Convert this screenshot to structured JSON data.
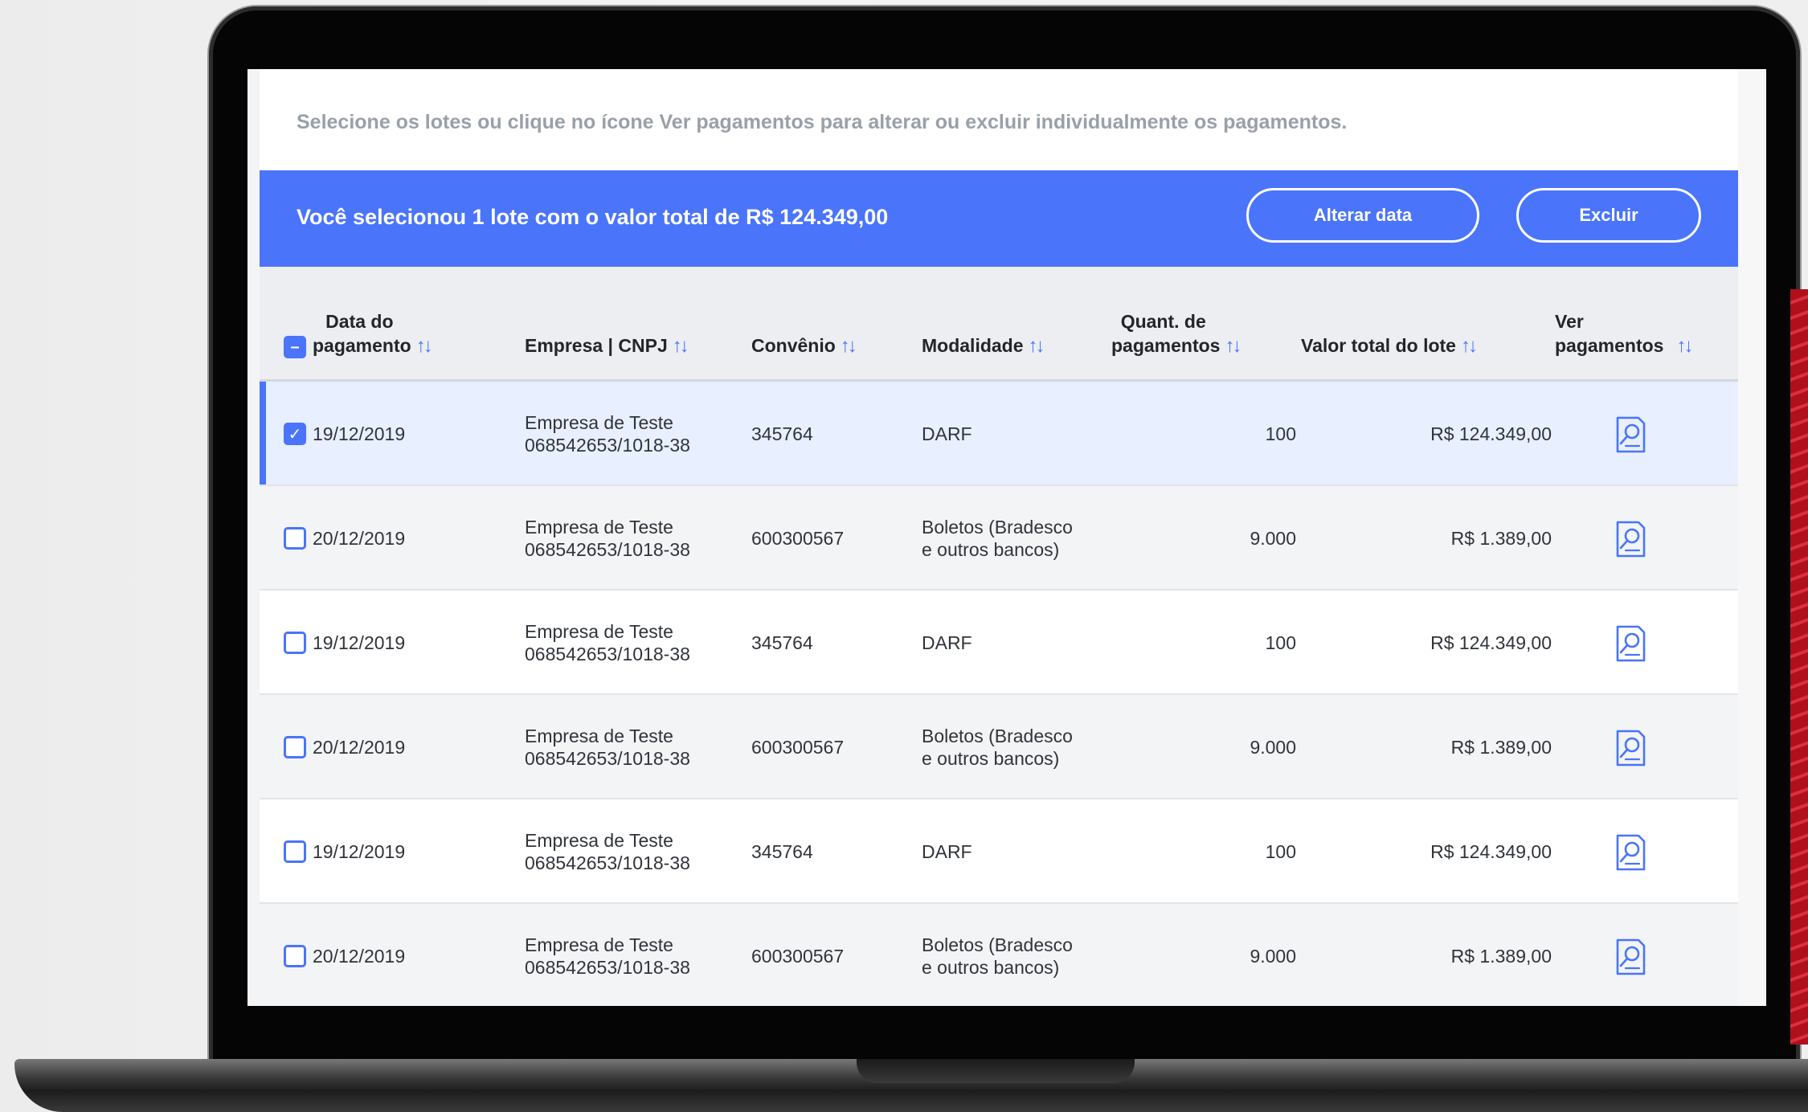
{
  "instructions": "Selecione os lotes ou clique no ícone Ver pagamentos para alterar ou excluir individualmente os pagamentos.",
  "selection_bar": {
    "text": "Você selecionou 1 lote com o valor total de R$ 124.349,00",
    "alterar_label": "Alterar data",
    "excluir_label": "Excluir"
  },
  "table": {
    "headers": {
      "data_l1": "Data do",
      "data_l2": "pagamento",
      "empresa": "Empresa | CNPJ",
      "convenio": "Convênio",
      "modalidade": "Modalidade",
      "quant_l1": "Quant. de",
      "quant_l2": "pagamentos",
      "valor": "Valor total do lote",
      "ver_l1": "Ver",
      "ver_l2": "pagamentos"
    },
    "sort_glyph": "↑↓",
    "rows": [
      {
        "date": "19/12/2019",
        "empresa": "Empresa de Teste",
        "cnpj": "068542653/1018-38",
        "convenio": "345764",
        "modalidade_l1": "DARF",
        "modalidade_l2": "",
        "quantidade": "100",
        "valor": "R$ 124.349,00",
        "checked": true
      },
      {
        "date": "20/12/2019",
        "empresa": "Empresa de Teste",
        "cnpj": "068542653/1018-38",
        "convenio": "600300567",
        "modalidade_l1": "Boletos (Bradesco",
        "modalidade_l2": "e outros bancos)",
        "quantidade": "9.000",
        "valor": "R$ 1.389,00",
        "checked": false
      },
      {
        "date": "19/12/2019",
        "empresa": "Empresa de Teste",
        "cnpj": "068542653/1018-38",
        "convenio": "345764",
        "modalidade_l1": "DARF",
        "modalidade_l2": "",
        "quantidade": "100",
        "valor": "R$ 124.349,00",
        "checked": false
      },
      {
        "date": "20/12/2019",
        "empresa": "Empresa de Teste",
        "cnpj": "068542653/1018-38",
        "convenio": "600300567",
        "modalidade_l1": "Boletos (Bradesco",
        "modalidade_l2": "e outros bancos)",
        "quantidade": "9.000",
        "valor": "R$ 1.389,00",
        "checked": false
      },
      {
        "date": "19/12/2019",
        "empresa": "Empresa de Teste",
        "cnpj": "068542653/1018-38",
        "convenio": "345764",
        "modalidade_l1": "DARF",
        "modalidade_l2": "",
        "quantidade": "100",
        "valor": "R$ 124.349,00",
        "checked": false
      },
      {
        "date": "20/12/2019",
        "empresa": "Empresa de Teste",
        "cnpj": "068542653/1018-38",
        "convenio": "600300567",
        "modalidade_l1": "Boletos (Bradesco",
        "modalidade_l2": "e outros bancos)",
        "quantidade": "9.000",
        "valor": "R$ 1.389,00",
        "checked": false
      }
    ]
  },
  "colors": {
    "accent": "#4a74f9",
    "selected_row": "#e8efff",
    "header_bg": "#eceef1"
  },
  "icons": {
    "view_payments": "document-search-icon",
    "checkbox_checked": "check-icon",
    "checkbox_partial": "minus-icon"
  }
}
